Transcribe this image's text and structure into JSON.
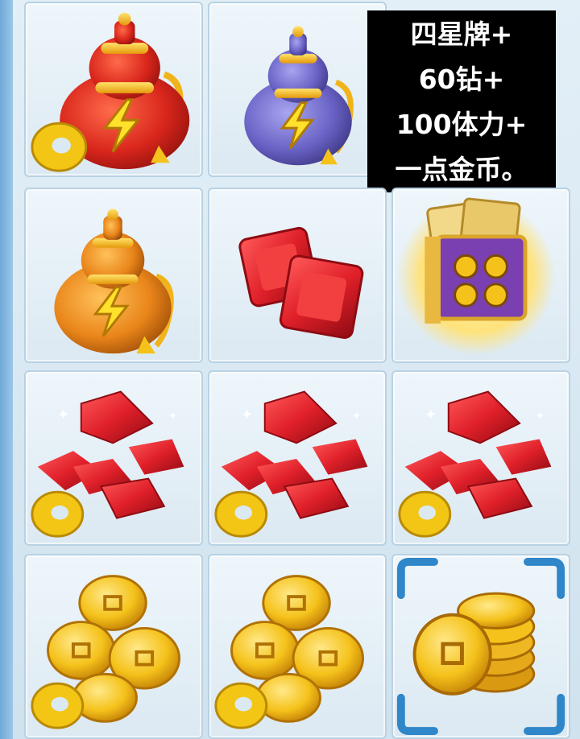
{
  "caption": {
    "lines": [
      "四星牌+",
      "60钻+",
      "100体力+",
      "一点金币。"
    ]
  },
  "inventory": {
    "selected_index": 11,
    "items": [
      {
        "icon": "red-energy-pouch-icon",
        "badge": "gold-ring-coin-icon"
      },
      {
        "icon": "purple-energy-pouch-icon",
        "badge": ""
      },
      {
        "icon": "four-star-card-icon",
        "badge": ""
      },
      {
        "icon": "orange-energy-pouch-icon",
        "badge": ""
      },
      {
        "icon": "ruby-gems-icon",
        "badge": ""
      },
      {
        "icon": "four-star-card-icon",
        "badge": ""
      },
      {
        "icon": "ruby-pile-icon",
        "badge": "gold-ring-coin-icon"
      },
      {
        "icon": "ruby-pile-icon",
        "badge": "gold-ring-coin-icon"
      },
      {
        "icon": "ruby-pile-icon",
        "badge": "gold-ring-coin-icon"
      },
      {
        "icon": "gold-coin-pile-icon",
        "badge": "gold-ring-coin-icon"
      },
      {
        "icon": "gold-coin-pile-icon",
        "badge": "gold-ring-coin-icon"
      },
      {
        "icon": "gold-coin-stack-icon",
        "badge": ""
      }
    ]
  },
  "colors": {
    "red_pouch": "#d9261c",
    "purple_pouch": "#6a63c6",
    "orange_pouch": "#e9851a",
    "ruby": "#e0202a",
    "gold": "#f5c21b",
    "select_frame": "#2f86c9"
  }
}
